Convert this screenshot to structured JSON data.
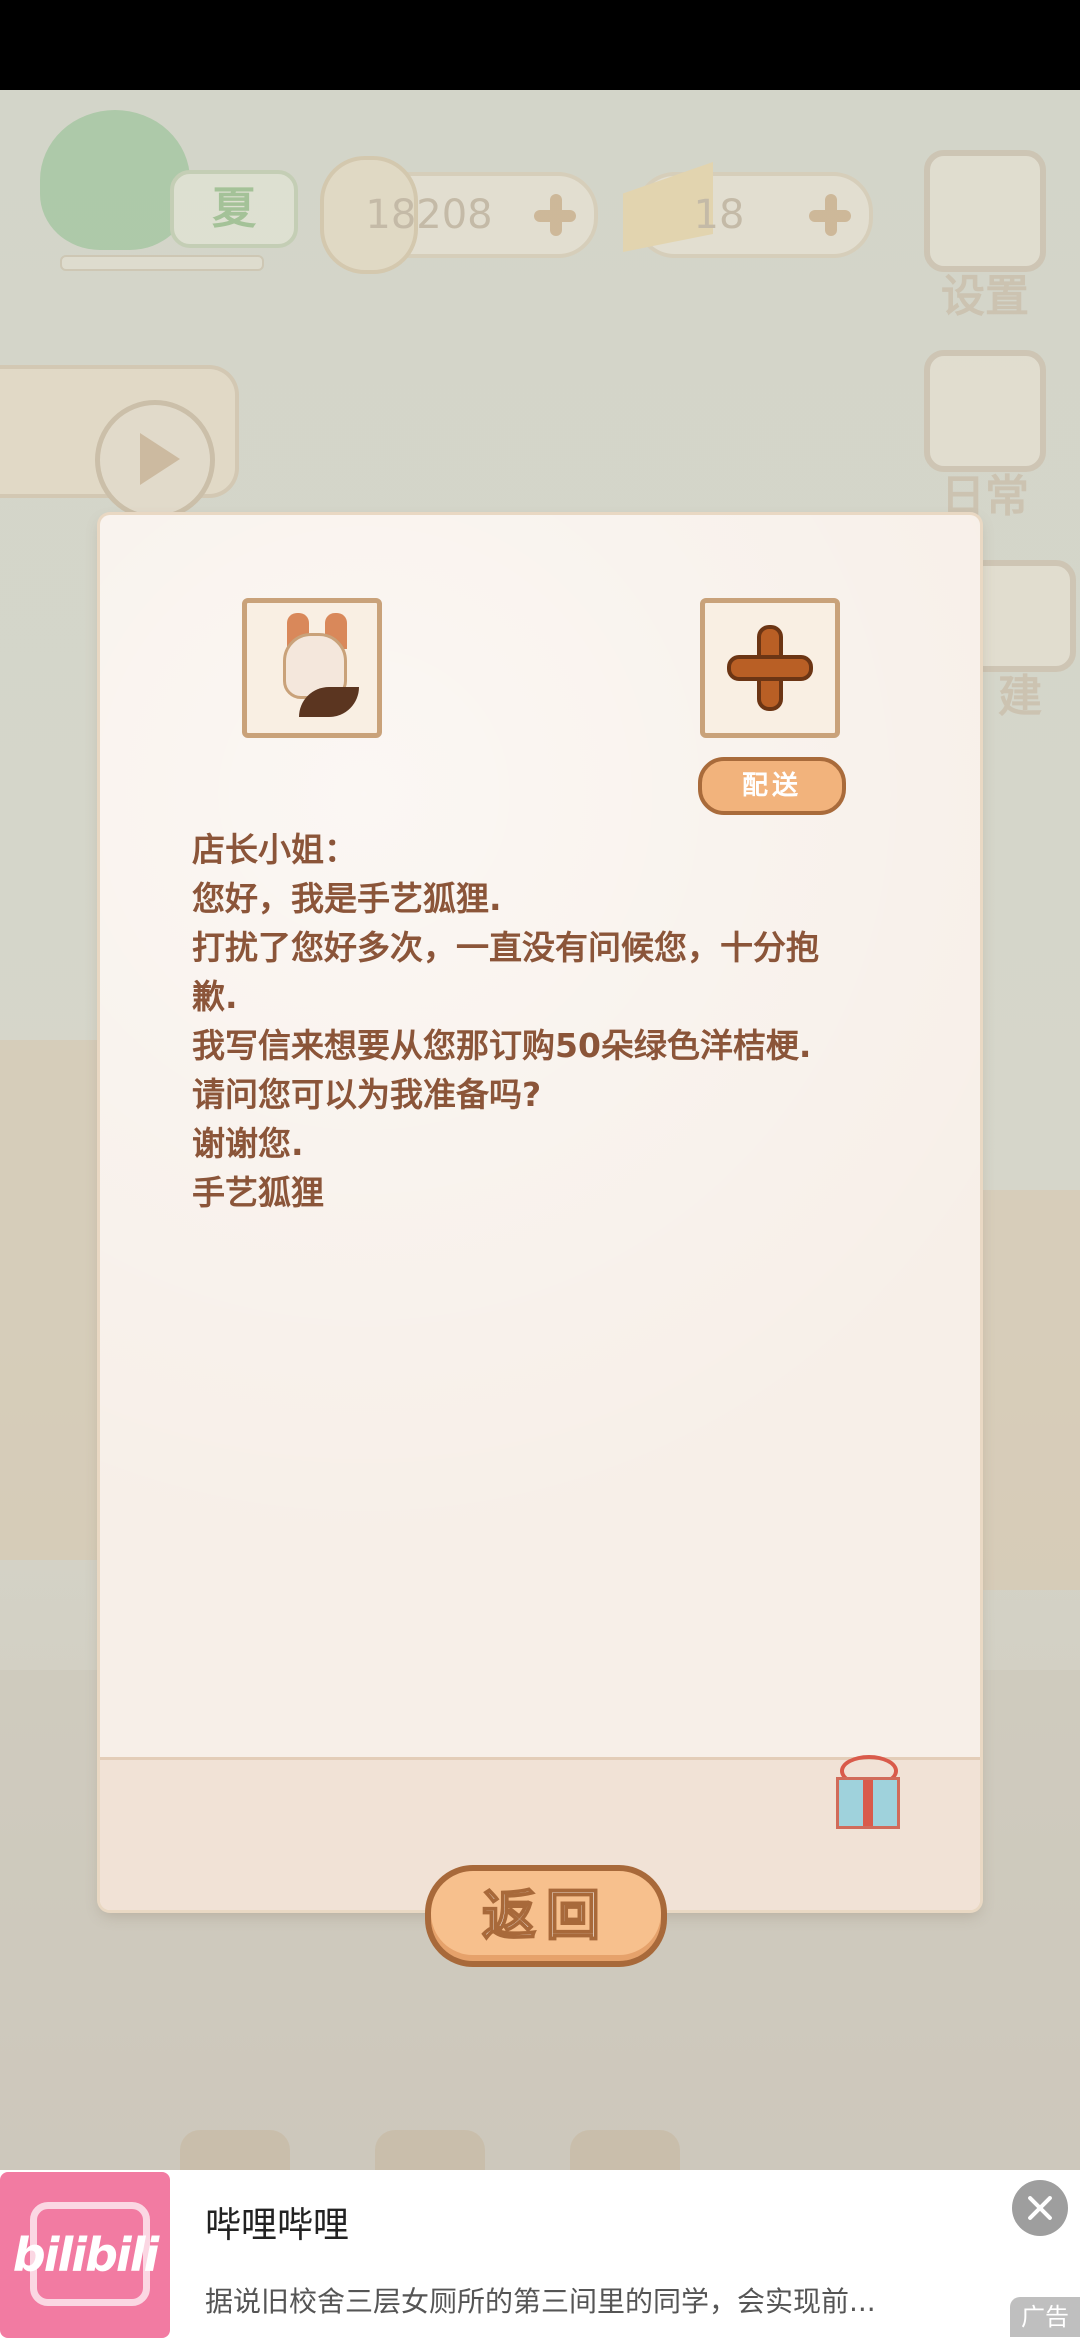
{
  "hud": {
    "season_label": "夏",
    "fish_count": "18208",
    "cheese_count": "18",
    "settings_label": "设置",
    "daily_label": "日常",
    "build_label": "建"
  },
  "letter": {
    "deliver_label": "配送",
    "lines": [
      "店长小姐：",
      "您好，我是手艺狐狸.",
      "打扰了您好多次，一直没有问候您，十分抱",
      "歉.",
      "我写信来想要从您那订购50朵绿色洋桔梗.",
      "请问您可以为我准备吗?",
      "谢谢您.",
      "手艺狐狸"
    ],
    "back_label": "返回"
  },
  "ad": {
    "logo_text": "bilibili",
    "title": "哔哩哔哩",
    "description": "据说旧校舍三层女厕所的第三间里的同学，会实现前...",
    "tag": "广告"
  }
}
